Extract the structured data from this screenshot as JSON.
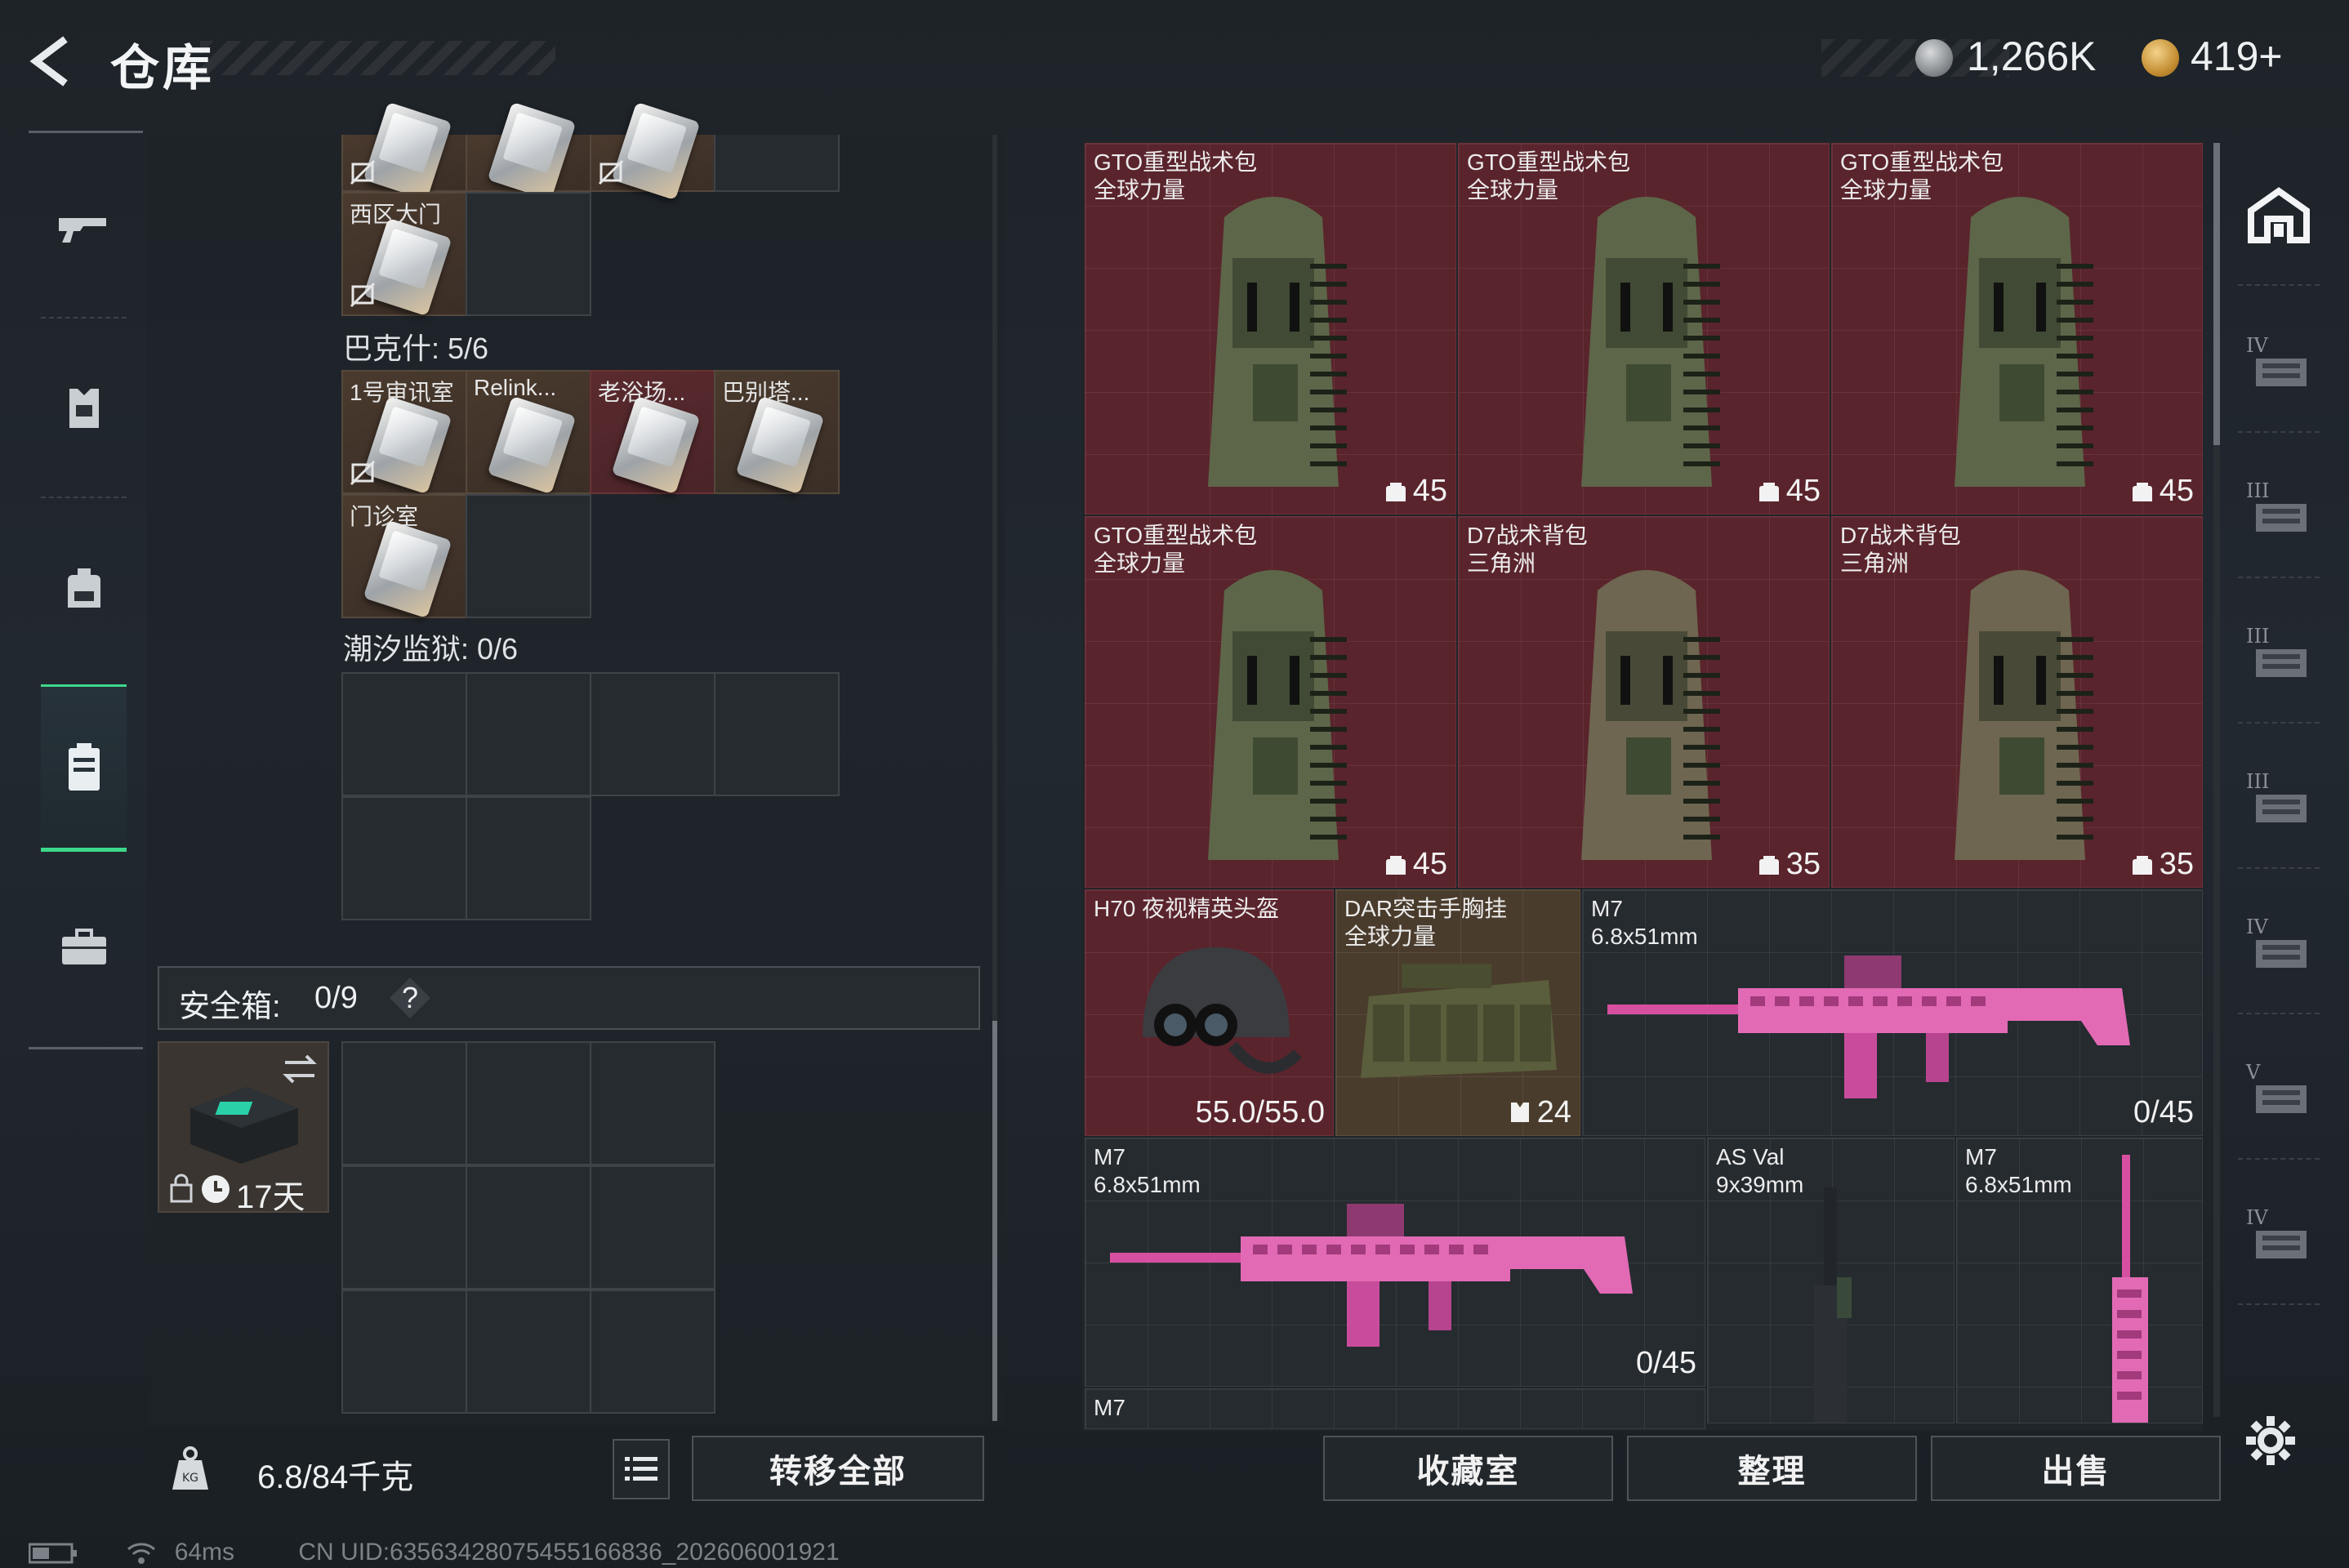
{
  "header": {
    "title": "仓库",
    "currency1_value": "1,266K",
    "currency2_value": "419+"
  },
  "left_nav": {
    "items": [
      {
        "icon": "gun-icon"
      },
      {
        "icon": "armor-vest-icon"
      },
      {
        "icon": "backpack-icon"
      },
      {
        "icon": "storage-box-icon",
        "active": true
      },
      {
        "icon": "briefcase-icon"
      }
    ]
  },
  "key_sections": [
    {
      "top_keys": [
        {
          "label": "",
          "no_bind": true
        },
        {
          "label": "",
          "no_bind": false
        },
        {
          "label": "",
          "no_bind": true
        }
      ],
      "keys": [
        {
          "label": "西区大门",
          "no_bind": true
        }
      ]
    },
    {
      "title": "巴克什: 5/6",
      "keys": [
        {
          "label": "1号审讯室",
          "no_bind": true
        },
        {
          "label": "Relink...",
          "no_bind": false
        },
        {
          "label": "老浴场...",
          "no_bind": false
        },
        {
          "label": "巴别塔...",
          "no_bind": false
        },
        {
          "label": "门诊室",
          "no_bind": false
        }
      ]
    },
    {
      "title": "潮汐监狱: 0/6",
      "keys": []
    }
  ],
  "safe_box": {
    "label": "安全箱:",
    "count": "0/9",
    "help": "?",
    "timer": "17天"
  },
  "footer_left": {
    "weight": "6.8/84千克",
    "transfer_all": "转移全部"
  },
  "items": [
    {
      "name": "GTO重型战术包\n全球力量",
      "value": "45",
      "bg": "red"
    },
    {
      "name": "GTO重型战术包\n全球力量",
      "value": "45",
      "bg": "red"
    },
    {
      "name": "GTO重型战术包\n全球力量",
      "value": "45",
      "bg": "red"
    },
    {
      "name": "GTO重型战术包\n全球力量",
      "value": "45",
      "bg": "red"
    },
    {
      "name": "D7战术背包\n三角洲",
      "value": "35",
      "bg": "red"
    },
    {
      "name": "D7战术背包\n三角洲",
      "value": "35",
      "bg": "red"
    },
    {
      "name": "H70 夜视精英头盔",
      "value": "55.0/55.0",
      "bg": "red"
    },
    {
      "name": "DAR突击手胸挂\n全球力量",
      "value": "24",
      "bg": "tan"
    },
    {
      "name": "M7\n6.8x51mm",
      "value": "0/45",
      "bg": "dark"
    },
    {
      "name": "M7\n6.8x51mm",
      "value": "0/45",
      "bg": "dark"
    },
    {
      "name": "AS Val\n9x39mm",
      "value": "",
      "bg": "dark"
    },
    {
      "name": "M7\n6.8x51mm",
      "value": "",
      "bg": "dark"
    },
    {
      "name": "M7",
      "value": "",
      "bg": "dark"
    }
  ],
  "footer_right": {
    "collection": "收藏室",
    "organize": "整理",
    "sell": "出售"
  },
  "right_nav": {
    "tiers": [
      "IV",
      "III",
      "III",
      "III",
      "IV",
      "V",
      "IV"
    ]
  },
  "status_bar": {
    "ping": "64ms",
    "uid": "CN UID:6356342807545516683​6_202606001921"
  },
  "colors": {
    "accent_green": "#3cd88a",
    "item_red": "#5a242c",
    "item_tan": "#4a3c2c"
  }
}
